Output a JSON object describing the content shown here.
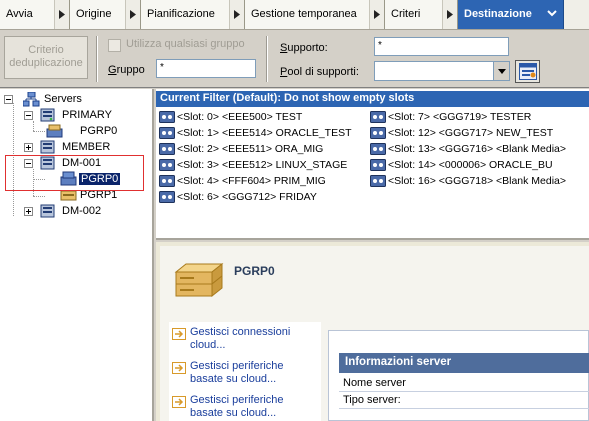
{
  "tabs": [
    {
      "label": "Avvia",
      "active": false
    },
    {
      "label": "Origine",
      "active": false
    },
    {
      "label": "Pianificazione",
      "active": false
    },
    {
      "label": "Gestione temporanea",
      "active": false
    },
    {
      "label": "Criteri",
      "active": false
    },
    {
      "label": "Destinazione",
      "active": true
    }
  ],
  "options": {
    "dedup_button_line1": "Criterio",
    "dedup_button_line2": "deduplicazione",
    "use_any_group_label": "Utilizza qualsiasi gruppo",
    "group_label_hotkey": "G",
    "group_label_rest": "ruppo",
    "group_value": "*",
    "support_label_hotkey": "S",
    "support_label_rest": "upporto:",
    "support_value": "*",
    "pool_label_hotkey": "P",
    "pool_label_rest": "ool di supporti:",
    "pool_value": ""
  },
  "tree": {
    "root": "Servers",
    "primary": "PRIMARY",
    "primary_child": "PGRP0",
    "member": "MEMBER",
    "dm001": "DM-001",
    "dm001_child_selected": "PGRP0",
    "dm001_child2": "PGRP1",
    "dm002": "DM-002"
  },
  "filter": {
    "header": "Current Filter (Default):  Do not show empty slots",
    "slots_left": [
      "<Slot:  0> <EEE500> TEST",
      "<Slot:  1> <EEE514> ORACLE_TEST",
      "<Slot:  2> <EEE511> ORA_MIG",
      "<Slot:  3> <EEE512> LINUX_STAGE",
      "<Slot:  4> <FFF604> PRIM_MIG",
      "<Slot:  6> <GGG712> FRIDAY"
    ],
    "slots_right": [
      "<Slot:  7> <GGG719> TESTER",
      "<Slot: 12> <GGG717> NEW_TEST",
      "<Slot: 13> <GGG716> <Blank Media>",
      "<Slot: 14> <000006> ORACLE_BU",
      "<Slot: 16> <GGG718> <Blank Media>"
    ]
  },
  "detail": {
    "title": "PGRP0",
    "tasks": [
      [
        "Gestisci connessioni",
        "cloud..."
      ],
      [
        "Gestisci periferiche",
        "basate su cloud..."
      ],
      [
        "Gestisci periferiche",
        "basate su cloud..."
      ]
    ],
    "info_header": "Informazioni server",
    "info_rows": [
      "Nome server",
      "Tipo server:"
    ]
  },
  "colors": {
    "active_tab": "#2d65b3",
    "filter_header": "#2d65b3",
    "selection_box": "#e03030",
    "info_header": "#4f6d9c"
  }
}
